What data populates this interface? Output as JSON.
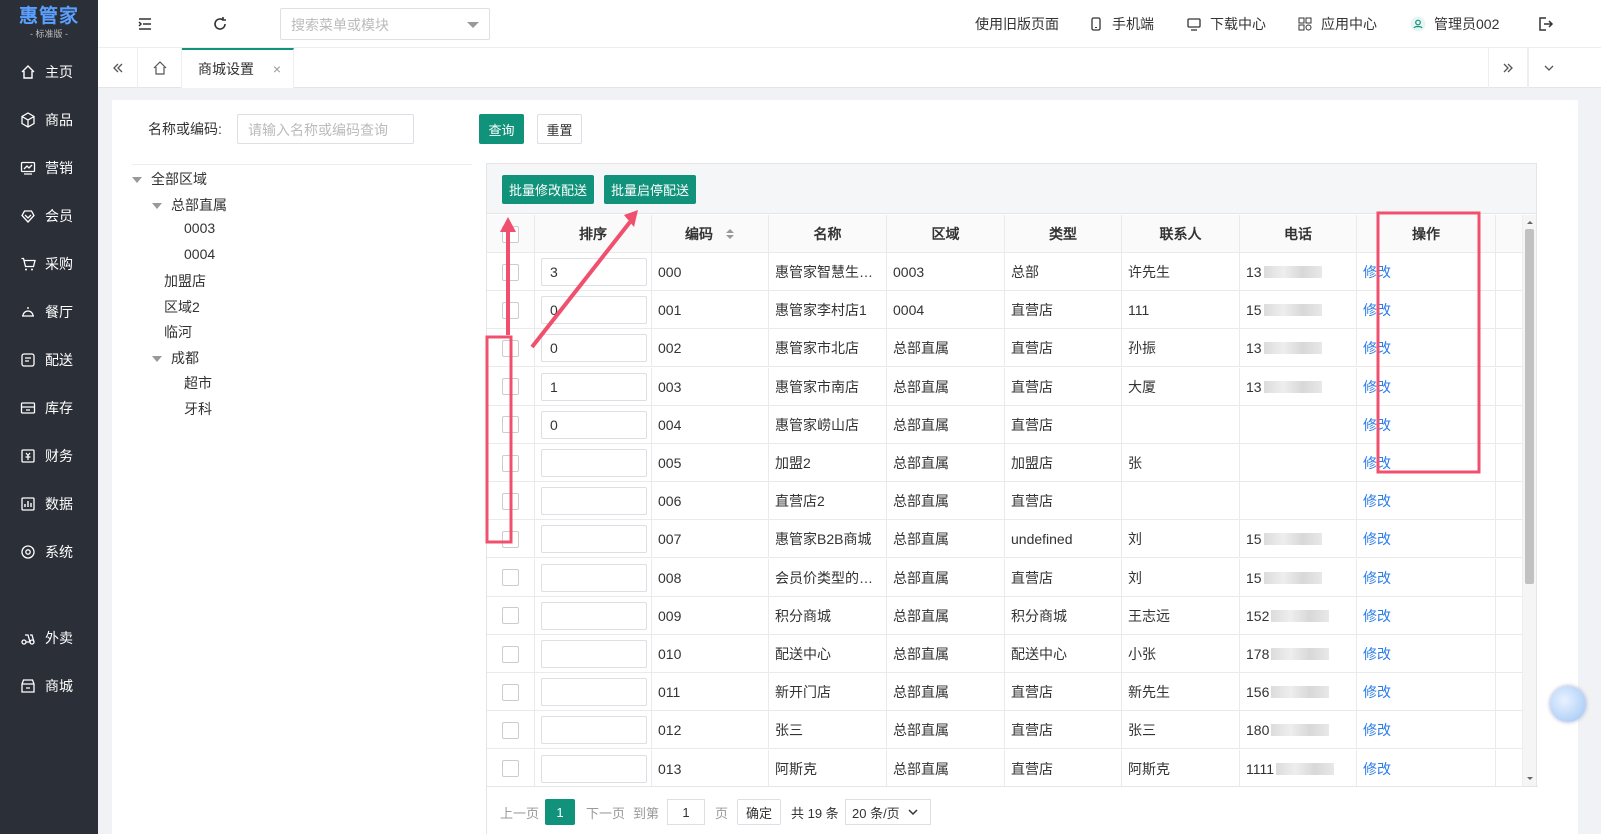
{
  "brand": {
    "name": "惠管家",
    "edition": "- 标准版 -"
  },
  "sidebar": {
    "items": [
      {
        "label": "主页",
        "icon": "home-icon"
      },
      {
        "label": "商品",
        "icon": "box-icon"
      },
      {
        "label": "营销",
        "icon": "marketing-icon"
      },
      {
        "label": "会员",
        "icon": "member-icon"
      },
      {
        "label": "采购",
        "icon": "purchase-icon"
      },
      {
        "label": "餐厅",
        "icon": "restaurant-icon"
      },
      {
        "label": "配送",
        "icon": "delivery-icon"
      },
      {
        "label": "库存",
        "icon": "inventory-icon"
      },
      {
        "label": "财务",
        "icon": "finance-icon"
      },
      {
        "label": "数据",
        "icon": "data-icon"
      },
      {
        "label": "系统",
        "icon": "system-icon"
      }
    ],
    "extra": [
      {
        "label": "外卖",
        "icon": "takeout-icon"
      },
      {
        "label": "商城",
        "icon": "mall-icon"
      }
    ]
  },
  "topbar": {
    "search_placeholder": "搜索菜单或模块",
    "old_page": "使用旧版页面",
    "mobile": "手机端",
    "download": "下载中心",
    "apps": "应用中心",
    "user": "管理员002"
  },
  "tabs": {
    "active": "商城设置",
    "close": "×"
  },
  "filter": {
    "label": "名称或编码:",
    "placeholder": "请输入名称或编码查询",
    "query": "查询",
    "reset": "重置"
  },
  "tree": [
    {
      "label": "全部区域",
      "level": 0,
      "expanded": true
    },
    {
      "label": "总部直属",
      "level": 1,
      "expanded": true
    },
    {
      "label": "0003",
      "level": 2
    },
    {
      "label": "0004",
      "level": 2
    },
    {
      "label": "加盟店",
      "level": 1
    },
    {
      "label": "区域2",
      "level": 1
    },
    {
      "label": "临河",
      "level": 1
    },
    {
      "label": "成都",
      "level": 1,
      "expanded": true
    },
    {
      "label": "超市",
      "level": 2
    },
    {
      "label": "牙科",
      "level": 2
    }
  ],
  "toolbar": {
    "batch_edit": "批量修改配送",
    "batch_toggle": "批量启停配送"
  },
  "table": {
    "headers": {
      "sort": "排序",
      "code": "编码",
      "name": "名称",
      "region": "区域",
      "type": "类型",
      "contact": "联系人",
      "phone": "电话",
      "action": "操作"
    },
    "rows": [
      {
        "sort": "3",
        "code": "000",
        "name": "惠管家智慧生…",
        "region": "0003",
        "type": "总部",
        "contact": "许先生",
        "phone": "13",
        "action": "修改"
      },
      {
        "sort": "0",
        "code": "001",
        "name": "惠管家李村店1",
        "region": "0004",
        "type": "直营店",
        "contact": "111",
        "phone": "15",
        "action": "修改"
      },
      {
        "sort": "0",
        "code": "002",
        "name": "惠管家市北店",
        "region": "总部直属",
        "type": "直营店",
        "contact": "孙振",
        "phone": "13",
        "action": "修改"
      },
      {
        "sort": "1",
        "code": "003",
        "name": "惠管家市南店",
        "region": "总部直属",
        "type": "直营店",
        "contact": "大厦",
        "phone": "13",
        "action": "修改"
      },
      {
        "sort": "0",
        "code": "004",
        "name": "惠管家崂山店",
        "region": "总部直属",
        "type": "直营店",
        "contact": "",
        "phone": "",
        "action": "修改"
      },
      {
        "sort": "",
        "code": "005",
        "name": "加盟2",
        "region": "总部直属",
        "type": "加盟店",
        "contact": "张",
        "phone": "",
        "action": "修改"
      },
      {
        "sort": "",
        "code": "006",
        "name": "直营店2",
        "region": "总部直属",
        "type": "直营店",
        "contact": "",
        "phone": "",
        "action": "修改"
      },
      {
        "sort": "",
        "code": "007",
        "name": "惠管家B2B商城",
        "region": "总部直属",
        "type": "undefined",
        "contact": "刘",
        "phone": "15",
        "action": "修改"
      },
      {
        "sort": "",
        "code": "008",
        "name": "会员价类型的…",
        "region": "总部直属",
        "type": "直营店",
        "contact": "刘",
        "phone": "15",
        "action": "修改"
      },
      {
        "sort": "",
        "code": "009",
        "name": "积分商城",
        "region": "总部直属",
        "type": "积分商城",
        "contact": "王志远",
        "phone": "152",
        "action": "修改"
      },
      {
        "sort": "",
        "code": "010",
        "name": "配送中心",
        "region": "总部直属",
        "type": "配送中心",
        "contact": "小张",
        "phone": "178",
        "action": "修改"
      },
      {
        "sort": "",
        "code": "011",
        "name": "新开门店",
        "region": "总部直属",
        "type": "直营店",
        "contact": "新先生",
        "phone": "156",
        "action": "修改"
      },
      {
        "sort": "",
        "code": "012",
        "name": "张三",
        "region": "总部直属",
        "type": "直营店",
        "contact": "张三",
        "phone": "180",
        "action": "修改"
      },
      {
        "sort": "",
        "code": "013",
        "name": "阿斯克",
        "region": "总部直属",
        "type": "直营店",
        "contact": "阿斯克",
        "phone": "1111",
        "action": "修改"
      }
    ]
  },
  "pager": {
    "prev": "上一页",
    "current": "1",
    "next": "下一页",
    "goto": "到第",
    "page_input": "1",
    "page_unit": "页",
    "confirm": "确定",
    "total": "共 19 条",
    "page_size": "20 条/页"
  },
  "colors": {
    "primary": "#11927a",
    "sidebar": "#2b2f38",
    "link": "#2b7de9",
    "annotation": "#f0506e"
  }
}
